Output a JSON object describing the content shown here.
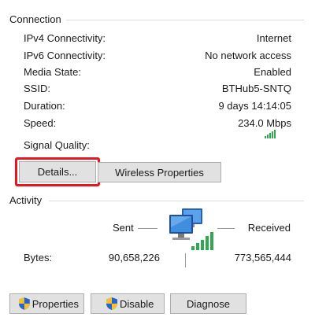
{
  "connection": {
    "title": "Connection",
    "rows": [
      {
        "label": "IPv4 Connectivity:",
        "value": "Internet"
      },
      {
        "label": "IPv6 Connectivity:",
        "value": "No network access"
      },
      {
        "label": "Media State:",
        "value": "Enabled"
      },
      {
        "label": "SSID:",
        "value": "BTHub5-SNTQ"
      },
      {
        "label": "Duration:",
        "value": "9 days 14:14:05"
      },
      {
        "label": "Speed:",
        "value": "234.0 Mbps"
      }
    ],
    "signal_label": "Signal Quality:",
    "signal_bars": 5,
    "buttons": {
      "details": "Details...",
      "wireless": "Wireless Properties"
    }
  },
  "activity": {
    "title": "Activity",
    "sent_label": "Sent",
    "received_label": "Received",
    "bytes_label": "Bytes:",
    "bytes_sent": "90,658,226",
    "bytes_received": "773,565,444"
  },
  "actions": {
    "properties": "Properties",
    "disable": "Disable",
    "diagnose": "Diagnose"
  },
  "colors": {
    "highlight": "#e8141e",
    "signal": "#2fa84f",
    "button_bg": "#e1e1e1"
  }
}
